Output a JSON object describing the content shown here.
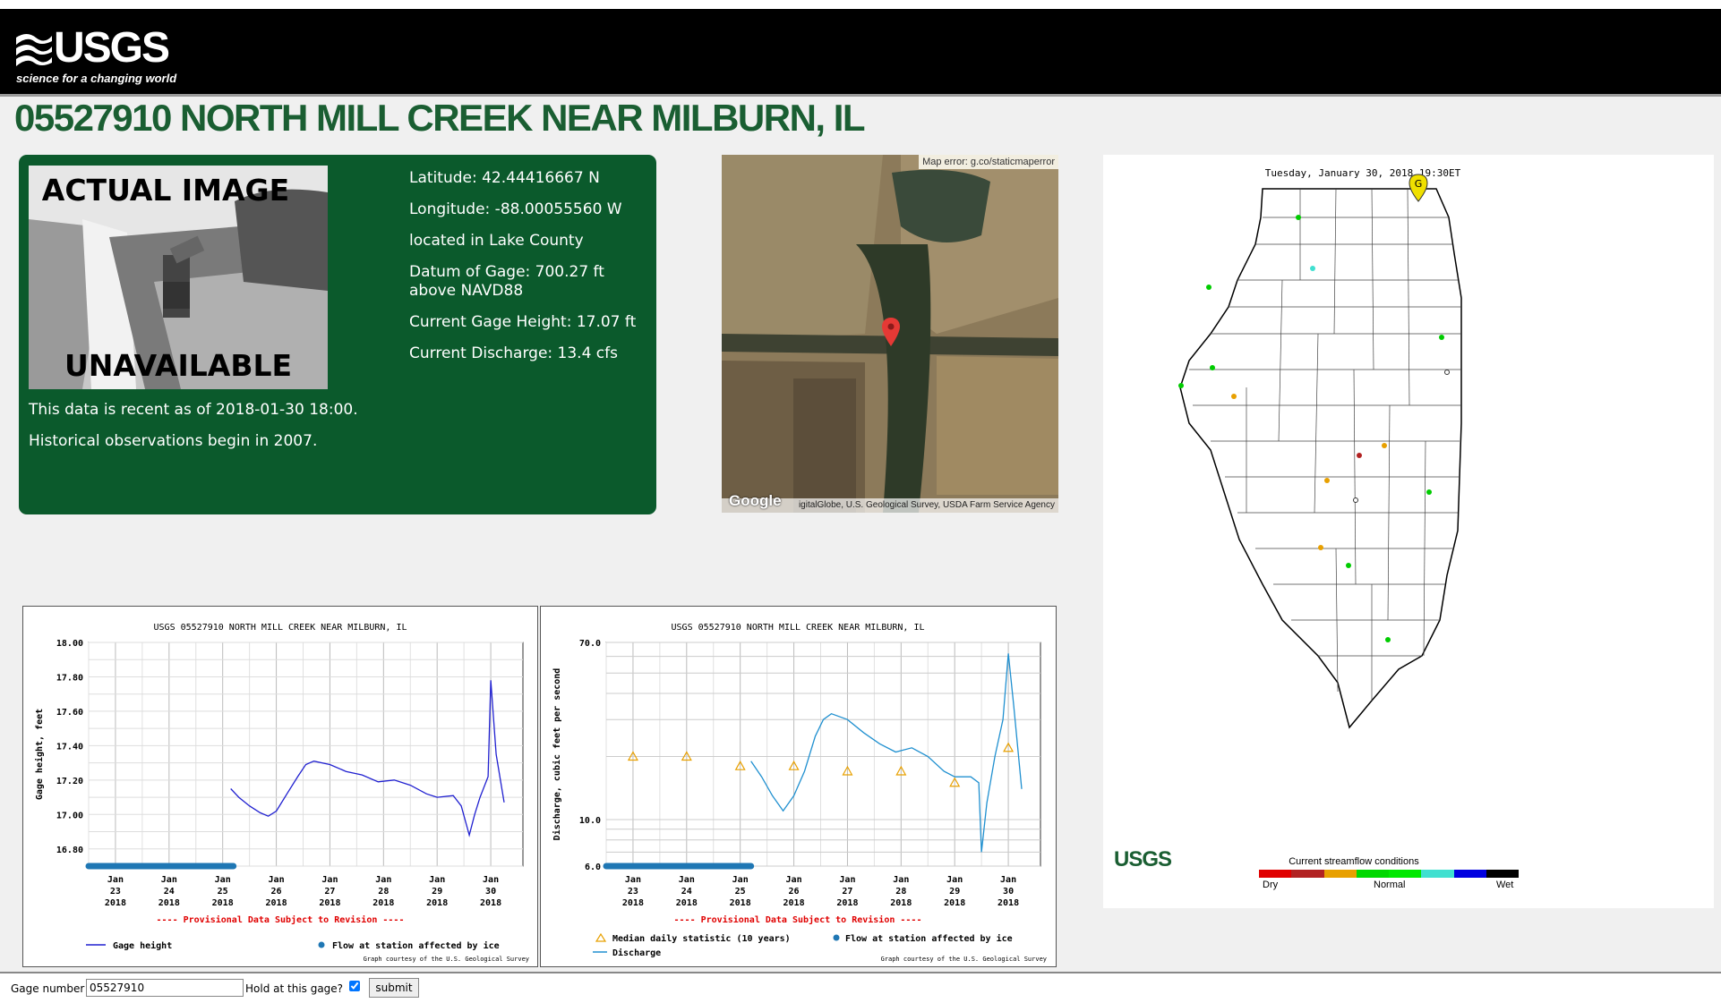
{
  "header": {
    "logo_word": "USGS",
    "logo_tagline": "science for a changing world"
  },
  "title": "05527910 NORTH MILL CREEK NEAR MILBURN, IL",
  "info": {
    "photo_caption_top": "ACTUAL IMAGE",
    "photo_caption_bottom": "UNAVAILABLE",
    "latitude": "Latitude: 42.44416667 N",
    "longitude": "Longitude: -88.00055560 W",
    "county": "located in Lake County",
    "datum": "Datum of Gage: 700.27 ft above NAVD88",
    "gage_height": "Current Gage Height: 17.07 ft",
    "discharge": "Current Discharge: 13.4 cfs",
    "recent": "This data is recent as of 2018-01-30 18:00.",
    "historical": "Historical observations begin in 2007."
  },
  "satellite_map": {
    "error_text": "Map error: g.co/staticmaperror",
    "google": "Google",
    "attribution": "igitalGlobe, U.S. Geological Survey, USDA Farm Service Agency"
  },
  "state_map": {
    "date": "Tuesday, January 30, 2018 19:30ET",
    "marker_letter": "G",
    "logo": "USGS",
    "legend_title": "Current streamflow conditions",
    "legend_dry": "Dry",
    "legend_normal": "Normal",
    "legend_wet": "Wet",
    "legend_colors": [
      "#e00000",
      "#b22222",
      "#e8a000",
      "#00d800",
      "#00e800",
      "#40e0d0",
      "#0000e0",
      "#000000"
    ]
  },
  "chart_data": [
    {
      "type": "line",
      "title": "USGS 05527910 NORTH MILL CREEK NEAR MILBURN, IL",
      "ylabel": "Gage height, feet",
      "ylim": [
        16.7,
        18.0
      ],
      "yticks": [
        "18.00",
        "17.80",
        "17.60",
        "17.40",
        "17.20",
        "17.00",
        "16.80"
      ],
      "x_labels": [
        [
          "Jan",
          "23",
          "2018"
        ],
        [
          "Jan",
          "24",
          "2018"
        ],
        [
          "Jan",
          "25",
          "2018"
        ],
        [
          "Jan",
          "26",
          "2018"
        ],
        [
          "Jan",
          "27",
          "2018"
        ],
        [
          "Jan",
          "28",
          "2018"
        ],
        [
          "Jan",
          "29",
          "2018"
        ],
        [
          "Jan",
          "30",
          "2018"
        ]
      ],
      "provisional": "---- Provisional Data Subject to Revision ----",
      "series": [
        {
          "name": "Gage height",
          "color": "#2020d0",
          "x": [
            25.15,
            25.3,
            25.5,
            25.7,
            25.85,
            26.0,
            26.2,
            26.4,
            26.55,
            26.7,
            27.0,
            27.3,
            27.6,
            27.9,
            28.2,
            28.5,
            28.8,
            29.0,
            29.3,
            29.45,
            29.6,
            29.7,
            29.8,
            29.95,
            30.0,
            30.1,
            30.25
          ],
          "y": [
            17.15,
            17.1,
            17.05,
            17.01,
            16.99,
            17.02,
            17.12,
            17.22,
            17.29,
            17.31,
            17.29,
            17.25,
            17.23,
            17.19,
            17.2,
            17.17,
            17.12,
            17.1,
            17.11,
            17.05,
            16.88,
            17.0,
            17.1,
            17.22,
            17.78,
            17.35,
            17.07
          ]
        }
      ],
      "ice_band": {
        "from": 22.5,
        "to": 25.2
      },
      "legend": [
        "Gage height",
        "Flow at station affected by ice"
      ],
      "credit": "Graph courtesy of the U.S. Geological Survey"
    },
    {
      "type": "line",
      "title": "USGS 05527910 NORTH MILL CREEK NEAR MILBURN, IL",
      "ylabel": "Discharge, cubic feet per second",
      "yscale": "log",
      "ylim": [
        6.0,
        70.0
      ],
      "yticks": [
        "70.0",
        "10.0",
        "6.0"
      ],
      "x_labels": [
        [
          "Jan",
          "23",
          "2018"
        ],
        [
          "Jan",
          "24",
          "2018"
        ],
        [
          "Jan",
          "25",
          "2018"
        ],
        [
          "Jan",
          "26",
          "2018"
        ],
        [
          "Jan",
          "27",
          "2018"
        ],
        [
          "Jan",
          "28",
          "2018"
        ],
        [
          "Jan",
          "29",
          "2018"
        ],
        [
          "Jan",
          "30",
          "2018"
        ]
      ],
      "provisional": "---- Provisional Data Subject to Revision ----",
      "series": [
        {
          "name": "Discharge",
          "color": "#2090d0",
          "x": [
            25.2,
            25.4,
            25.6,
            25.8,
            26.0,
            26.2,
            26.4,
            26.55,
            26.7,
            27.0,
            27.3,
            27.6,
            27.9,
            28.2,
            28.5,
            28.8,
            29.0,
            29.3,
            29.45,
            29.5,
            29.6,
            29.75,
            29.9,
            30.0,
            30.1,
            30.25
          ],
          "y": [
            19,
            16,
            13,
            11,
            13,
            17,
            25,
            30,
            32,
            30,
            26,
            23,
            21,
            22,
            20,
            17,
            16,
            16,
            15,
            7,
            12,
            20,
            30,
            62,
            35,
            14
          ]
        },
        {
          "name": "Median daily statistic (10 years)",
          "color": "#e8a000",
          "x": [
            23,
            24,
            25,
            26,
            27,
            28,
            29,
            30
          ],
          "y": [
            20,
            20,
            18,
            18,
            17,
            17,
            15,
            22
          ]
        }
      ],
      "ice_band": {
        "from": 22.5,
        "to": 25.2
      },
      "legend": [
        "Median daily statistic (10 years)",
        "Flow at station affected by ice",
        "Discharge"
      ],
      "credit": "Graph courtesy of the U.S. Geological Survey"
    }
  ],
  "footer": {
    "gage_label": "Gage number",
    "gage_value": "05527910",
    "hold_label": "Hold at this gage?",
    "submit": "submit"
  }
}
